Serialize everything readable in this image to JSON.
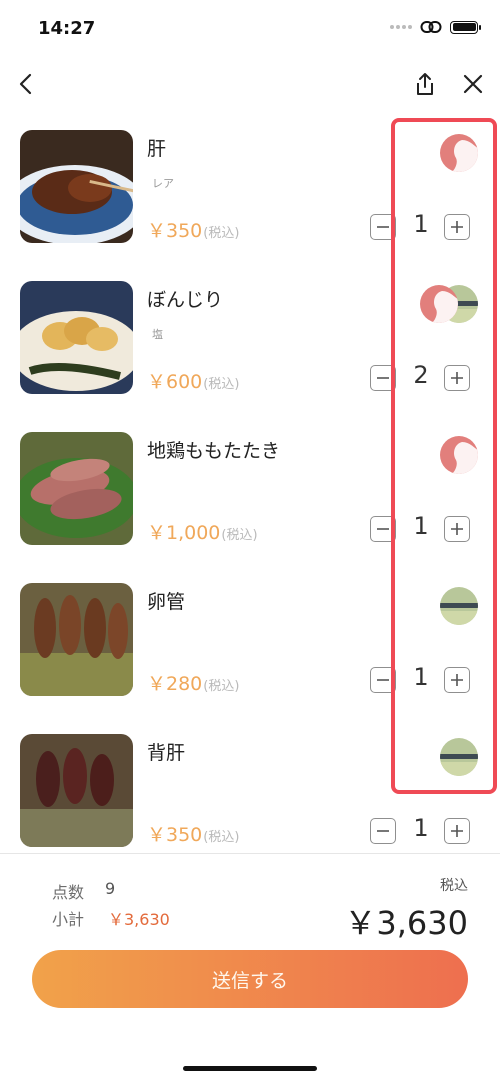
{
  "status_bar": {
    "time": "14:27"
  },
  "nav": {
    "back_icon": "chevron-left-icon",
    "share_icon": "share-icon",
    "close_icon": "close-icon"
  },
  "items": [
    {
      "name": "肝",
      "option": "レア",
      "price": "￥350",
      "tax_note": "(税込)",
      "quantity": "1",
      "avatars": [
        "red"
      ]
    },
    {
      "name": "ぼんじり",
      "option": "塩",
      "price": "￥600",
      "tax_note": "(税込)",
      "quantity": "2",
      "avatars": [
        "red",
        "green"
      ]
    },
    {
      "name": "地鶏ももたたき",
      "option": "",
      "price": "￥1,000",
      "tax_note": "(税込)",
      "quantity": "1",
      "avatars": [
        "red"
      ]
    },
    {
      "name": "卵管",
      "option": "",
      "price": "￥280",
      "tax_note": "(税込)",
      "quantity": "1",
      "avatars": [
        "green"
      ]
    },
    {
      "name": "背肝",
      "option": "",
      "price": "￥350",
      "tax_note": "(税込)",
      "quantity": "1",
      "avatars": [
        "green"
      ]
    }
  ],
  "footer": {
    "count_label": "点数",
    "count_value": "9",
    "subtotal_label": "小計",
    "subtotal_value": "￥3,630",
    "tax_label": "税込",
    "total": "￥3,630",
    "send_label": "送信する"
  },
  "colors": {
    "price": "#f0a85a",
    "subtotal": "#e36a3b",
    "button_gradient_start": "#f1a24a",
    "button_gradient_end": "#ee6f4f",
    "highlight": "#ef4a55"
  }
}
